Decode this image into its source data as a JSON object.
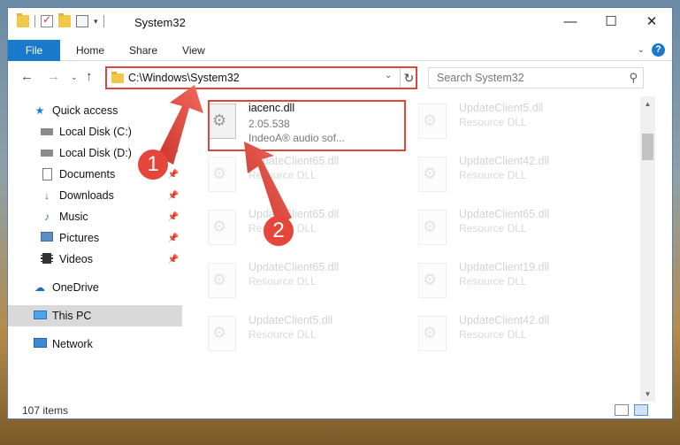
{
  "window": {
    "title": "System32"
  },
  "ribbon": {
    "tabs": [
      "File",
      "Home",
      "Share",
      "View"
    ]
  },
  "address": {
    "path": "C:\\Windows\\System32"
  },
  "search": {
    "placeholder": "Search System32"
  },
  "sidebar": {
    "items": [
      {
        "label": "Quick access",
        "icon": "star-icon"
      },
      {
        "label": "Local Disk (C:)",
        "icon": "drive-icon"
      },
      {
        "label": "Local Disk (D:)",
        "icon": "drive-icon"
      },
      {
        "label": "Documents",
        "icon": "document-icon"
      },
      {
        "label": "Downloads",
        "icon": "download-icon"
      },
      {
        "label": "Music",
        "icon": "music-icon"
      },
      {
        "label": "Pictures",
        "icon": "pictures-icon"
      },
      {
        "label": "Videos",
        "icon": "videos-icon"
      },
      {
        "label": "OneDrive",
        "icon": "cloud-icon"
      },
      {
        "label": "This PC",
        "icon": "computer-icon"
      },
      {
        "label": "Network",
        "icon": "network-icon"
      }
    ]
  },
  "files": [
    {
      "name": "iacenc.dll",
      "line1": "2.05.538",
      "line2": "IndeoA® audio sof..."
    },
    {
      "name": "UpdateClient5.dll",
      "line1": "Resource DLL"
    },
    {
      "name": "UpdateClient65.dll",
      "line1": "Resource DLL"
    },
    {
      "name": "UpdateClient42.dll",
      "line1": "Resource DLL"
    },
    {
      "name": "UpdateClient65.dll",
      "line1": "Resource DLL"
    },
    {
      "name": "UpdateClient65.dll",
      "line1": "Resource DLL"
    },
    {
      "name": "UpdateClient65.dll",
      "line1": "Resource DLL"
    },
    {
      "name": "UpdateClient19.dll",
      "line1": "Resource DLL"
    },
    {
      "name": "UpdateClient5.dll",
      "line1": "Resource DLL"
    },
    {
      "name": "UpdateClient42.dll",
      "line1": "Resource DLL"
    }
  ],
  "status": {
    "count": "107 items"
  },
  "annotations": {
    "step1": "1",
    "step2": "2",
    "color": "#e0453c"
  }
}
